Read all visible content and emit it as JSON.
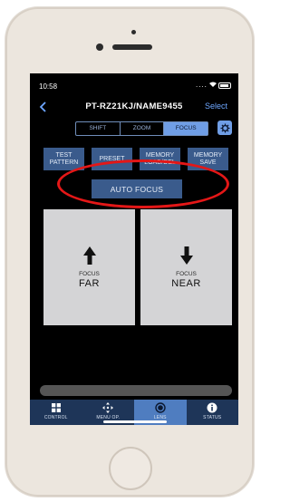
{
  "status": {
    "time": "10:58",
    "dots": "...."
  },
  "nav": {
    "title": "PT-RZ21KJ/NAME9455",
    "select": "Select"
  },
  "tabs": [
    "SHIFT",
    "ZOOM",
    "FOCUS"
  ],
  "active_tab": "FOCUS",
  "buttons": {
    "test_pattern": "TEST PATTERN",
    "preset": "PRESET",
    "memory_load": "MEMORY LOAD/DEL",
    "memory_save": "MEMORY SAVE",
    "auto_focus": "AUTO FOCUS"
  },
  "focus_far": {
    "label": "FOCUS",
    "direction": "FAR",
    "icon": "arrow-up-icon"
  },
  "focus_near": {
    "label": "FOCUS",
    "direction": "NEAR",
    "icon": "arrow-down-icon"
  },
  "tabbar": [
    {
      "label": "CONTROL",
      "icon": "grid-icon"
    },
    {
      "label": "MENU OP.",
      "icon": "dpad-icon"
    },
    {
      "label": "LENS",
      "icon": "lens-icon"
    },
    {
      "label": "STATUS",
      "icon": "info-icon"
    }
  ],
  "active_tabbar": "LENS",
  "colors": {
    "accent": "#6f9ee6",
    "button": "#3a5b8c",
    "highlight_ring": "#e41717",
    "tabbar": "#1e3558"
  }
}
